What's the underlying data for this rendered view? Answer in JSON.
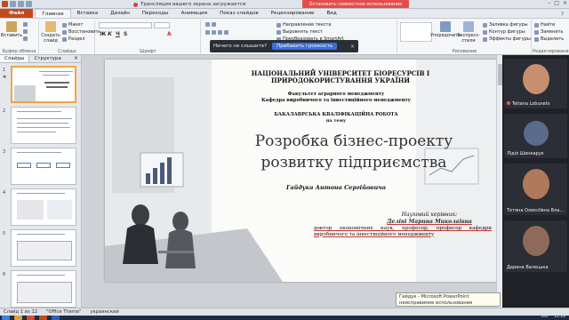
{
  "titlebar": {
    "stream_notice": "Трансляция вашего экрана загружается",
    "stop_share": "Остановить совместное использование",
    "controls": [
      "–",
      "□",
      "×"
    ]
  },
  "menu": {
    "file": "Файл",
    "tabs": [
      "Главная",
      "Вставка",
      "Дизайн",
      "Переходы",
      "Анимация",
      "Показ слайдов",
      "Рецензирование",
      "Вид"
    ],
    "active": "Главная",
    "help": "?"
  },
  "ribbon": {
    "paste": "Вставить",
    "clipboard_group": "Буфер обмена",
    "new_slide": "Создать слайд",
    "layout": "Макет",
    "reset": "Восстановить",
    "section": "Раздел",
    "slides_group": "Слайды",
    "font_group": "Шрифт",
    "paragraph_group": "Абзац",
    "text_direction": "Направление текста",
    "align_text": "Выровнять текст",
    "smartart": "Преобразовать в SmartArt",
    "arrange": "Упорядочить",
    "quick_styles": "Экспресс-стили",
    "shape_fill": "Заливка фигуры",
    "shape_outline": "Контур фигуры",
    "shape_effects": "Эффекты фигуры",
    "drawing_group": "Рисование",
    "find": "Найти",
    "replace": "Заменить",
    "select": "Выделить",
    "editing_group": "Редактирование"
  },
  "popup": {
    "message": "Ничего не слышите?",
    "button": "Прибавить громкость",
    "close": "×"
  },
  "thumbpane": {
    "tabs": [
      "Слайды",
      "Структура"
    ],
    "close": "×",
    "numbers": [
      "1",
      "2",
      "3",
      "4",
      "5",
      "6"
    ],
    "star": "✱"
  },
  "slide": {
    "university": "НАЦІОНАЛЬНИЙ УНІВЕРСИТЕТ БІОРЕСУРСІВ І ПРИРОДОКОРИСТУВАННЯ УКРАЇНИ",
    "faculty": "Факультет аграрного менеджменту",
    "department": "Кафедра виробничого та інвестиційного менеджменту",
    "work_type": "БАКАЛАВРСЬКА КВАЛІФІКАЦІЙНА РОБОТА",
    "topic_label": "на тему",
    "title": "Розробка бізнес-проекту розвитку підприємства",
    "author": "Гайдука Антона Сергійовича",
    "supervisor_caption": "Науковий керівник:",
    "supervisor_name": "Деліні Марина Миколаївна",
    "supervisor_info": "доктор економічних наук, професор, професор кафедри виробничого та інвестиційного менеджменту"
  },
  "participants": [
    {
      "name": "Tetiana Lobunets",
      "avatar_color": "#c98e6e"
    },
    {
      "name": "Лідія Шинкарук",
      "avatar_color": "#5b6b8c"
    },
    {
      "name": "Тетяна Олексіївна Вла...",
      "avatar_color": "#b07a5a"
    },
    {
      "name": "Дарина Валецька",
      "avatar_color": "#8f6a5a"
    }
  ],
  "statusbar": {
    "slide_info": "Слайд 1 из 12",
    "theme": "\"Office Theme\"",
    "language": "украинский"
  },
  "tooltip": {
    "text": "Гайдук - Microsoft PowerPoint неисправимое использование"
  },
  "tray": {
    "lang": "УКР",
    "time": "12:18"
  },
  "colors": {
    "file_tab": "#c44a1e",
    "stop_share": "#e44c4c",
    "popup_button": "#3a6fd8",
    "selected_thumb_border": "#f0a640",
    "participants_bg": "#1f2126"
  }
}
